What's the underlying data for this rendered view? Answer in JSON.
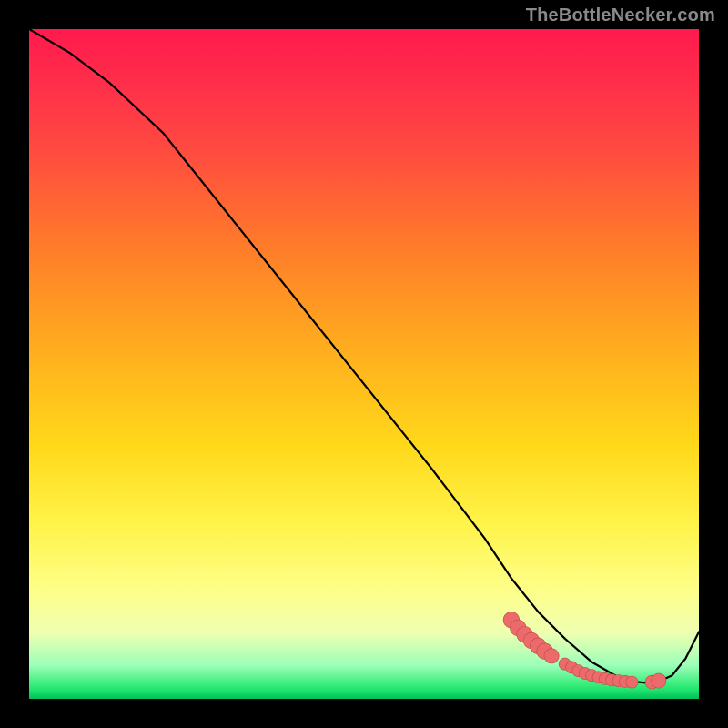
{
  "watermark": "TheBottleNecker.com",
  "colors": {
    "curve_stroke": "#000000",
    "marker_fill": "#ed6a6a",
    "marker_stroke": "#bb4a4a",
    "background": "#000000"
  },
  "chart_data": {
    "type": "line",
    "title": "",
    "xlabel": "",
    "ylabel": "",
    "xlim": [
      0,
      100
    ],
    "ylim": [
      0,
      100
    ],
    "grid": false,
    "legend": false,
    "series": [
      {
        "name": "curve",
        "x": [
          0,
          6,
          12,
          20,
          30,
          40,
          50,
          60,
          68,
          72,
          76,
          80,
          84,
          88,
          90,
          92,
          94,
          96,
          98,
          100
        ],
        "y": [
          100,
          96.5,
          92,
          84.5,
          72,
          59.5,
          47,
          34.5,
          24,
          18,
          13,
          9,
          5.5,
          3.2,
          2.6,
          2.4,
          2.6,
          3.5,
          6,
          10
        ]
      }
    ],
    "markers": [
      {
        "x": 72,
        "y": 11.8,
        "r": 1.2
      },
      {
        "x": 73,
        "y": 10.6,
        "r": 1.2
      },
      {
        "x": 74,
        "y": 9.6,
        "r": 1.2
      },
      {
        "x": 75,
        "y": 8.7,
        "r": 1.2
      },
      {
        "x": 76,
        "y": 7.9,
        "r": 1.2
      },
      {
        "x": 77,
        "y": 7.1,
        "r": 1.2
      },
      {
        "x": 78,
        "y": 6.4,
        "r": 1.1
      },
      {
        "x": 80,
        "y": 5.2,
        "r": 0.9
      },
      {
        "x": 81,
        "y": 4.7,
        "r": 0.9
      },
      {
        "x": 82,
        "y": 4.2,
        "r": 0.9
      },
      {
        "x": 83,
        "y": 3.8,
        "r": 0.9
      },
      {
        "x": 84,
        "y": 3.5,
        "r": 0.9
      },
      {
        "x": 85,
        "y": 3.2,
        "r": 0.9
      },
      {
        "x": 86,
        "y": 3.0,
        "r": 0.9
      },
      {
        "x": 87,
        "y": 2.8,
        "r": 0.9
      },
      {
        "x": 88,
        "y": 2.7,
        "r": 0.9
      },
      {
        "x": 89,
        "y": 2.6,
        "r": 0.9
      },
      {
        "x": 90,
        "y": 2.5,
        "r": 0.9
      },
      {
        "x": 93,
        "y": 2.5,
        "r": 1.0
      },
      {
        "x": 94,
        "y": 2.7,
        "r": 1.1
      }
    ]
  }
}
